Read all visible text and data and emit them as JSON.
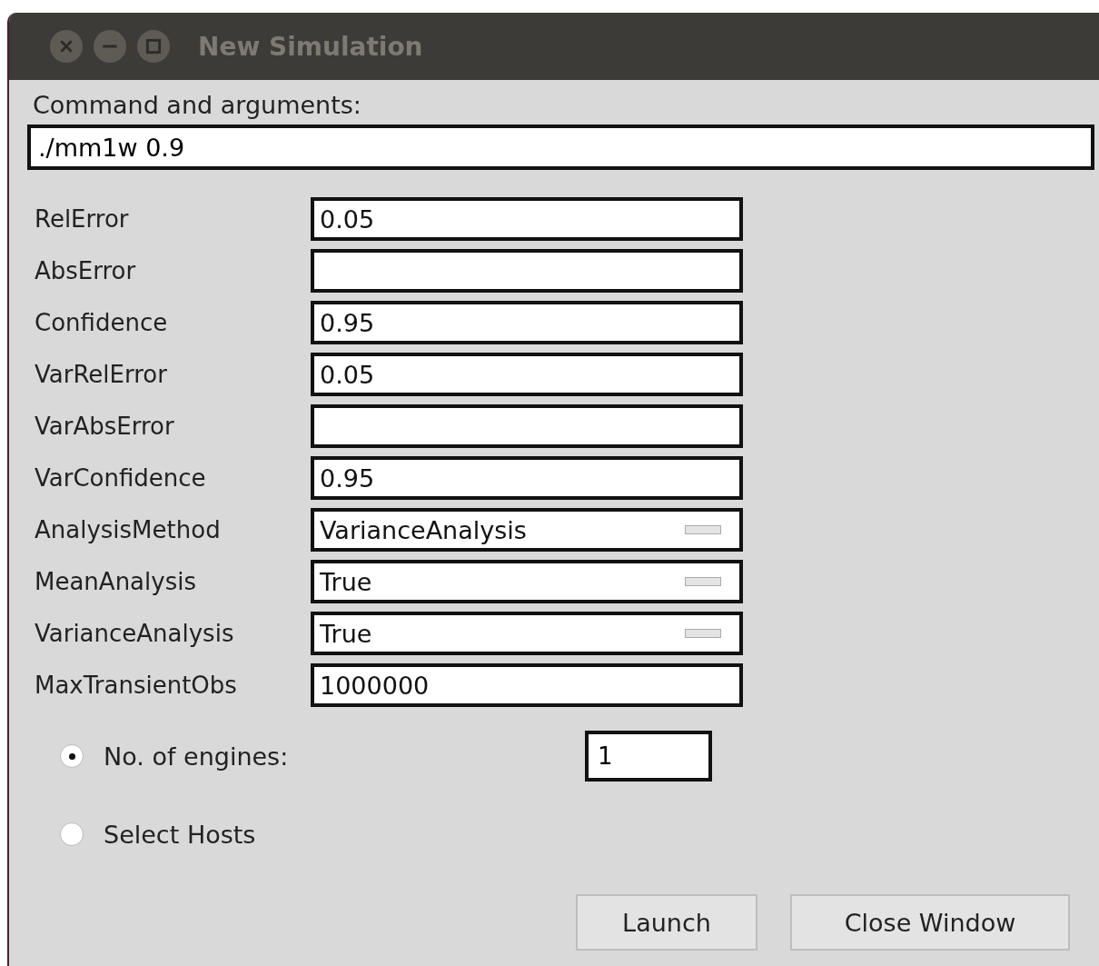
{
  "window": {
    "title": "New Simulation"
  },
  "command": {
    "label": "Command and arguments:",
    "value": "./mm1w 0.9"
  },
  "fields": [
    {
      "label": "RelError",
      "kind": "entry",
      "value": "0.05"
    },
    {
      "label": "AbsError",
      "kind": "entry"
    },
    {
      "label": "Confidence",
      "kind": "entry",
      "value": "0.95"
    },
    {
      "label": "VarRelError",
      "kind": "entry",
      "value": "0.05"
    },
    {
      "label": "VarAbsError",
      "kind": "entry"
    },
    {
      "label": "VarConfidence",
      "kind": "entry",
      "value": "0.95"
    },
    {
      "label": "AnalysisMethod",
      "kind": "dropdown",
      "value": "VarianceAnalysis"
    },
    {
      "label": "MeanAnalysis",
      "kind": "dropdown",
      "value": "True"
    },
    {
      "label": "VarianceAnalysis",
      "kind": "dropdown",
      "value": "True"
    },
    {
      "label": "MaxTransientObs",
      "kind": "entry",
      "value": "1000000"
    }
  ],
  "engine_options": [
    {
      "label": "No. of engines:",
      "selected": true,
      "value": "1"
    },
    {
      "label": "Select Hosts",
      "selected": false
    }
  ],
  "buttons": [
    "Launch",
    "Close Window"
  ]
}
